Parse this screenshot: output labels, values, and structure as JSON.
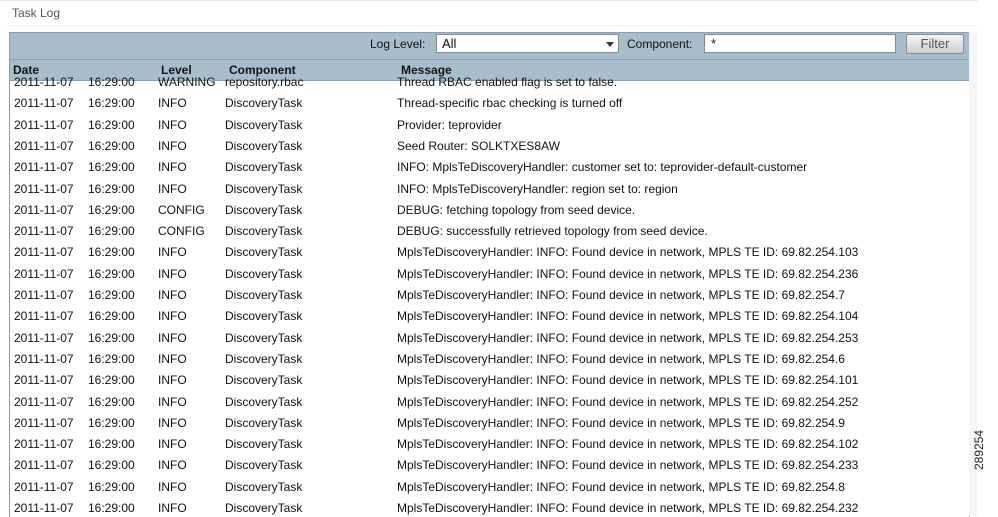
{
  "page": {
    "title": "Task Log",
    "figure_id": "289254"
  },
  "filter": {
    "log_level_label": "Log Level:",
    "log_level_value": "All",
    "component_label": "Component:",
    "component_value": "*",
    "filter_button": "Filter"
  },
  "columns": {
    "date": "Date",
    "level": "Level",
    "component": "Component",
    "message": "Message"
  },
  "rows": [
    {
      "date": "2011-11-07",
      "time": "16:29:00",
      "level": "WARNING",
      "component": "repository.rbac",
      "message": "Thread RBAC enabled flag is set to false."
    },
    {
      "date": "2011-11-07",
      "time": "16:29:00",
      "level": "INFO",
      "component": "DiscoveryTask",
      "message": "Thread-specific rbac checking is turned off"
    },
    {
      "date": "2011-11-07",
      "time": "16:29:00",
      "level": "INFO",
      "component": "DiscoveryTask",
      "message": "Provider: teprovider"
    },
    {
      "date": "2011-11-07",
      "time": "16:29:00",
      "level": "INFO",
      "component": "DiscoveryTask",
      "message": "Seed Router: SOLKTXES8AW"
    },
    {
      "date": "2011-11-07",
      "time": "16:29:00",
      "level": "INFO",
      "component": "DiscoveryTask",
      "message": "INFO: MplsTeDiscoveryHandler: customer set to: teprovider-default-customer"
    },
    {
      "date": "2011-11-07",
      "time": "16:29:00",
      "level": "INFO",
      "component": "DiscoveryTask",
      "message": "INFO: MplsTeDiscoveryHandler: region set to: region"
    },
    {
      "date": "2011-11-07",
      "time": "16:29:00",
      "level": "CONFIG",
      "component": "DiscoveryTask",
      "message": "DEBUG: fetching topology from seed device."
    },
    {
      "date": "2011-11-07",
      "time": "16:29:00",
      "level": "CONFIG",
      "component": "DiscoveryTask",
      "message": "DEBUG: successfully retrieved topology from seed device."
    },
    {
      "date": "2011-11-07",
      "time": "16:29:00",
      "level": "INFO",
      "component": "DiscoveryTask",
      "message": "MplsTeDiscoveryHandler: INFO: Found device in network, MPLS TE ID: 69.82.254.103"
    },
    {
      "date": "2011-11-07",
      "time": "16:29:00",
      "level": "INFO",
      "component": "DiscoveryTask",
      "message": "MplsTeDiscoveryHandler: INFO: Found device in network, MPLS TE ID: 69.82.254.236"
    },
    {
      "date": "2011-11-07",
      "time": "16:29:00",
      "level": "INFO",
      "component": "DiscoveryTask",
      "message": "MplsTeDiscoveryHandler: INFO: Found device in network, MPLS TE ID: 69.82.254.7"
    },
    {
      "date": "2011-11-07",
      "time": "16:29:00",
      "level": "INFO",
      "component": "DiscoveryTask",
      "message": "MplsTeDiscoveryHandler: INFO: Found device in network, MPLS TE ID: 69.82.254.104"
    },
    {
      "date": "2011-11-07",
      "time": "16:29:00",
      "level": "INFO",
      "component": "DiscoveryTask",
      "message": "MplsTeDiscoveryHandler: INFO: Found device in network, MPLS TE ID: 69.82.254.253"
    },
    {
      "date": "2011-11-07",
      "time": "16:29:00",
      "level": "INFO",
      "component": "DiscoveryTask",
      "message": "MplsTeDiscoveryHandler: INFO: Found device in network, MPLS TE ID: 69.82.254.6"
    },
    {
      "date": "2011-11-07",
      "time": "16:29:00",
      "level": "INFO",
      "component": "DiscoveryTask",
      "message": "MplsTeDiscoveryHandler: INFO: Found device in network, MPLS TE ID: 69.82.254.101"
    },
    {
      "date": "2011-11-07",
      "time": "16:29:00",
      "level": "INFO",
      "component": "DiscoveryTask",
      "message": "MplsTeDiscoveryHandler: INFO: Found device in network, MPLS TE ID: 69.82.254.252"
    },
    {
      "date": "2011-11-07",
      "time": "16:29:00",
      "level": "INFO",
      "component": "DiscoveryTask",
      "message": "MplsTeDiscoveryHandler: INFO: Found device in network, MPLS TE ID: 69.82.254.9"
    },
    {
      "date": "2011-11-07",
      "time": "16:29:00",
      "level": "INFO",
      "component": "DiscoveryTask",
      "message": "MplsTeDiscoveryHandler: INFO: Found device in network, MPLS TE ID: 69.82.254.102"
    },
    {
      "date": "2011-11-07",
      "time": "16:29:00",
      "level": "INFO",
      "component": "DiscoveryTask",
      "message": "MplsTeDiscoveryHandler: INFO: Found device in network, MPLS TE ID: 69.82.254.233"
    },
    {
      "date": "2011-11-07",
      "time": "16:29:00",
      "level": "INFO",
      "component": "DiscoveryTask",
      "message": "MplsTeDiscoveryHandler: INFO: Found device in network, MPLS TE ID: 69.82.254.8"
    },
    {
      "date": "2011-11-07",
      "time": "16:29:00",
      "level": "INFO",
      "component": "DiscoveryTask",
      "message": "MplsTeDiscoveryHandler: INFO: Found device in network, MPLS TE ID: 69.82.254.232"
    }
  ]
}
